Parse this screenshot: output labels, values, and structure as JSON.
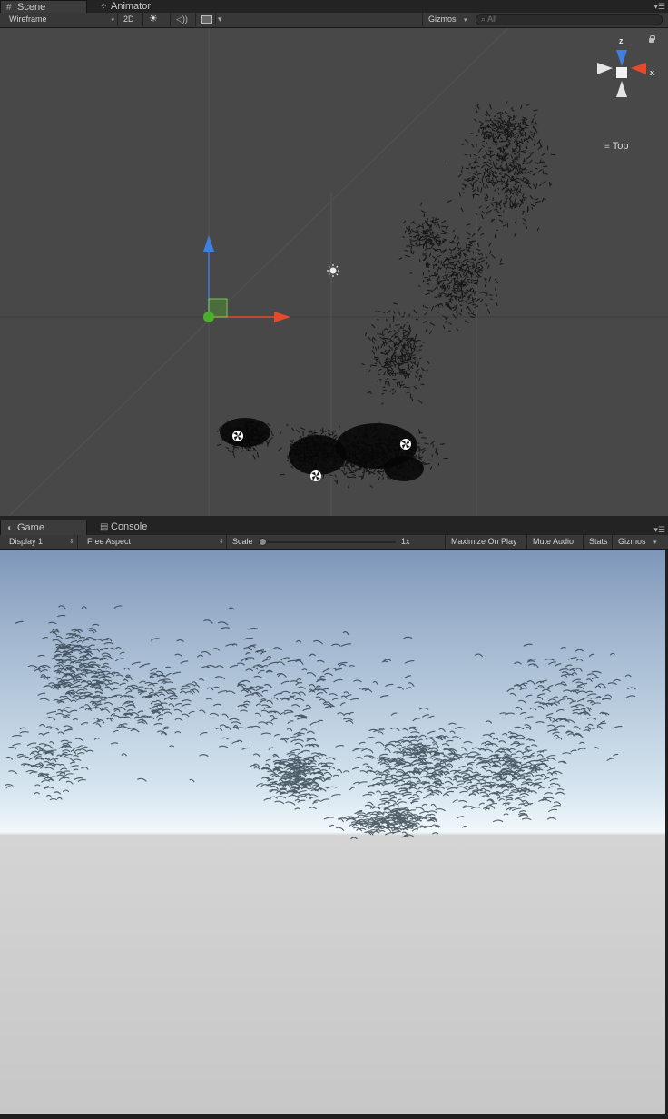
{
  "scene": {
    "tabs": [
      {
        "label": "Scene",
        "icon": "grid-icon"
      },
      {
        "label": "Animator",
        "icon": "animator-icon"
      }
    ],
    "panel_menu": "▾☰",
    "toolbar": {
      "shading_mode": "Wireframe",
      "mode_2d": "2D",
      "lighting_icon": "sun-icon",
      "audio_icon": "speaker-icon",
      "effects_icon": "image-icon",
      "effects_dropdown": "▾",
      "gizmos": "Gizmos",
      "search_placeholder": "All",
      "search_icon": "magnifier-icon"
    },
    "gizmo": {
      "axis_y": "z",
      "axis_x": "x",
      "projection": "Top",
      "lock_icon": "lock-icon"
    }
  },
  "game": {
    "tabs": [
      {
        "label": "Game",
        "icon": "pacman-icon"
      },
      {
        "label": "Console",
        "icon": "console-icon"
      }
    ],
    "panel_menu": "▾☰",
    "toolbar": {
      "display": "Display 1",
      "aspect": "Free Aspect",
      "scale_label": "Scale",
      "scale_value": "1x",
      "scale_level": 0,
      "maximize_on_play": "Maximize On Play",
      "mute_audio": "Mute Audio",
      "stats": "Stats",
      "gizmos": "Gizmos"
    }
  },
  "colors": {
    "scene_background": "#484848",
    "toolbar": "#383838",
    "axis_x": "#e8492b",
    "axis_y": "#3f7fe0",
    "origin": "#4caf2c",
    "sky_top": "#7d96ba",
    "horizon": "#f2f8fb",
    "ground": "#c9c9c9"
  }
}
